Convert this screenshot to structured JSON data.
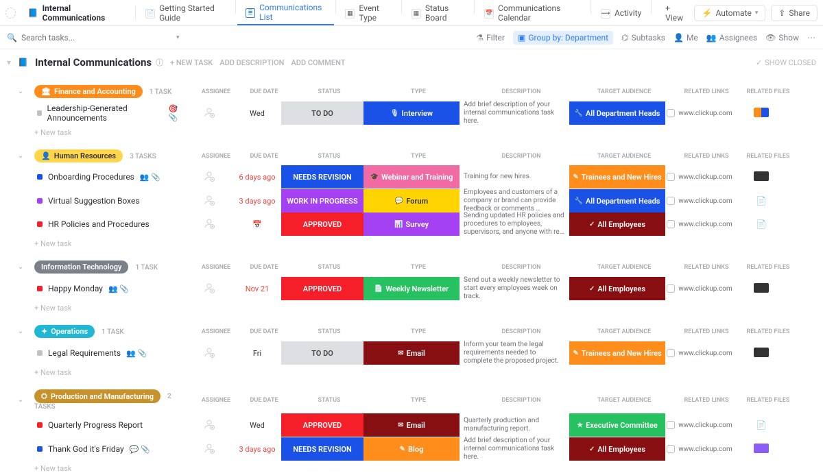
{
  "topnav": {
    "brand": "Internal Communications",
    "tabs": [
      {
        "label": "Getting Started Guide",
        "ico": "doc"
      },
      {
        "label": "Communications List",
        "ico": "list",
        "active": true
      },
      {
        "label": "Event Type",
        "ico": "board"
      },
      {
        "label": "Status Board",
        "ico": "board"
      },
      {
        "label": "Communications Calendar",
        "ico": "cal"
      },
      {
        "label": "Activity",
        "ico": "pulse"
      },
      {
        "label": "+ View",
        "ico": ""
      }
    ],
    "automate": "Automate",
    "share": "Share"
  },
  "filterbar": {
    "search_placeholder": "Search tasks...",
    "filter": "Filter",
    "groupby": "Group by: Department",
    "subtasks": "Subtasks",
    "me": "Me",
    "assignees": "Assignees",
    "show": "Show"
  },
  "workspace": {
    "title": "Internal Communications",
    "new_task": "+ NEW TASK",
    "add_desc": "ADD DESCRIPTION",
    "add_comment": "ADD COMMENT",
    "show_closed": "SHOW CLOSED"
  },
  "columns": [
    "ASSIGNEE",
    "DUE DATE",
    "STATUS",
    "TYPE",
    "DESCRIPTION",
    "TARGET AUDIENCE",
    "RELATED LINKS",
    "RELATED FILES"
  ],
  "new_task_label": "+ New task",
  "link_text": "www.clickup.com",
  "groups": [
    {
      "name": "Finance and Accounting",
      "pill": "pill-orange",
      "count": "1 TASK",
      "icon": "🏛",
      "rows": [
        {
          "sq": "#bfc1c3",
          "name": "Leadership-Generated Announcements",
          "extra": [
            "🎯",
            "📎"
          ],
          "due": "Wed",
          "dueClass": "",
          "status": {
            "label": "TO DO",
            "cls": "c-gray"
          },
          "type": {
            "label": "Interview",
            "ico": "🎙",
            "cls": "c-blue"
          },
          "desc": "Add brief description of your internal communications task here.",
          "aud": {
            "label": "All Department Heads",
            "ico": "🔧",
            "cls": "c-blue"
          },
          "file": "ft-mix"
        }
      ]
    },
    {
      "name": "Human Resources",
      "pill": "pill-yellow",
      "count": "3 TASKS",
      "icon": "👤",
      "rows": [
        {
          "sq": "#1a52e8",
          "name": "Onboarding Procedures",
          "extra": [
            "👥",
            "📎"
          ],
          "due": "6 days ago",
          "dueClass": "late",
          "status": {
            "label": "NEEDS REVISION",
            "cls": "c-blue"
          },
          "type": {
            "label": "Webinar and Training",
            "ico": "🎓",
            "cls": "c-pink"
          },
          "desc": "Training for new hires.",
          "aud": {
            "label": "Trainees and New Hires",
            "ico": "✎",
            "cls": "c-orange"
          },
          "file": "ft-dark"
        },
        {
          "sq": "#a441f3",
          "name": "Virtual Suggestion Boxes",
          "extra": [],
          "due": "3 days ago",
          "dueClass": "late",
          "status": {
            "label": "WORK IN PROGRESS",
            "cls": "c-purple"
          },
          "type": {
            "label": "Forum",
            "ico": "💬",
            "cls": "c-yellow"
          },
          "desc": "Employees and customers of a company or brand can provide feedback or comments …",
          "aud": {
            "label": "All Department Heads",
            "ico": "🔧",
            "cls": "c-blue"
          },
          "file": "outline"
        },
        {
          "sq": "#f51f29",
          "name": "HR Policies and Procedures",
          "extra": [],
          "due": "",
          "dueClass": "",
          "status": {
            "label": "APPROVED",
            "cls": "c-red"
          },
          "type": {
            "label": "Survey",
            "ico": "📊",
            "cls": "c-purple"
          },
          "desc": "Sending updated HR policies and procedures to employees, supervisors, and anyone with re…",
          "aud": {
            "label": "All Employees",
            "ico": "✓",
            "cls": "c-darkred"
          },
          "file": "outline"
        }
      ]
    },
    {
      "name": "Information Technology",
      "pill": "pill-gray",
      "count": "1 TASK",
      "icon": "",
      "rows": [
        {
          "sq": "#f51f29",
          "name": "Happy Monday",
          "extra": [
            "👥",
            "📎"
          ],
          "due": "Nov 21",
          "dueClass": "late",
          "status": {
            "label": "APPROVED",
            "cls": "c-red"
          },
          "type": {
            "label": "Weekly Newsletter",
            "ico": "📄",
            "cls": "c-green"
          },
          "desc": "Send out a weekly newsletter to start every employees week on track.",
          "aud": {
            "label": "All Employees",
            "ico": "✓",
            "cls": "c-darkred"
          },
          "file": "ft-dark"
        }
      ]
    },
    {
      "name": "Operations",
      "pill": "pill-teal",
      "count": "1 TASK",
      "icon": "✦",
      "rows": [
        {
          "sq": "#bfc1c3",
          "name": "Legal Requirements",
          "extra": [
            "👥",
            "📎"
          ],
          "due": "Fri",
          "dueClass": "",
          "status": {
            "label": "TO DO",
            "cls": "c-gray"
          },
          "type": {
            "label": "Email",
            "ico": "✉",
            "cls": "c-darkred"
          },
          "desc": "Inform your team the legal requirements needed to complete the proposed project.",
          "aud": {
            "label": "Trainees and New Hires",
            "ico": "✎",
            "cls": "c-orange"
          },
          "file": "ft-dark"
        }
      ]
    },
    {
      "name": "Production and Manufacturing",
      "pill": "pill-brown",
      "count": "2 TASKS",
      "icon": "⛭",
      "rows": [
        {
          "sq": "#f51f29",
          "name": "Quarterly Progress Report",
          "extra": [],
          "due": "Wed",
          "dueClass": "",
          "status": {
            "label": "APPROVED",
            "cls": "c-red"
          },
          "type": {
            "label": "Email",
            "ico": "✉",
            "cls": "c-darkred"
          },
          "desc": "Quarterly production and manufacturing report.",
          "aud": {
            "label": "Executive Committee",
            "ico": "★",
            "cls": "c-green"
          },
          "file": "outline"
        },
        {
          "sq": "#1a52e8",
          "name": "Thank God it's Friday",
          "extra": [
            "💬",
            "📎"
          ],
          "due": "3 days ago",
          "dueClass": "late",
          "status": {
            "label": "NEEDS REVISION",
            "cls": "c-blue"
          },
          "type": {
            "label": "Blog",
            "ico": "✎",
            "cls": "c-orange"
          },
          "desc": "Add brief description of your internal communications task here.",
          "aud": {
            "label": "All Employees",
            "ico": "✓",
            "cls": "c-darkred"
          },
          "file": "ft-purple"
        }
      ]
    }
  ]
}
